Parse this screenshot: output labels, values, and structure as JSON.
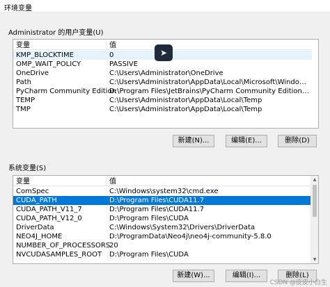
{
  "window": {
    "title": "环境变量"
  },
  "user_vars": {
    "group_label": "Administrator 的用户变量(U)",
    "columns": [
      "变量",
      "值"
    ],
    "rows": [
      {
        "name": "KMP_BLOCKTIME",
        "value": "0"
      },
      {
        "name": "OMP_WAIT_POLICY",
        "value": "PASSIVE"
      },
      {
        "name": "OneDrive",
        "value": "C:\\Users\\Administrator\\OneDrive"
      },
      {
        "name": "Path",
        "value": "C:\\Users\\Administrator\\AppData\\Local\\Microsoft\\WindowsApps;D..."
      },
      {
        "name": "PyCharm Community Edition",
        "value": "D:\\Program Files\\JetBrains\\PyCharm Community Edition 2022.3.2\\..."
      },
      {
        "name": "TEMP",
        "value": "C:\\Users\\Administrator\\AppData\\Local\\Temp"
      },
      {
        "name": "TMP",
        "value": "C:\\Users\\Administrator\\AppData\\Local\\Temp"
      }
    ],
    "buttons": {
      "new": "新建(N)...",
      "edit": "编辑(E)...",
      "delete": "删除(D)"
    }
  },
  "system_vars": {
    "group_label": "系统变量(S)",
    "columns": [
      "变量",
      "值"
    ],
    "rows": [
      {
        "name": "ComSpec",
        "value": "C:\\Windows\\system32\\cmd.exe"
      },
      {
        "name": "CUDA_PATH",
        "value": "D:\\Program Files\\CUDA11.7"
      },
      {
        "name": "CUDA_PATH_V11_7",
        "value": "D:\\Program Files\\CUDA11.7"
      },
      {
        "name": "CUDA_PATH_V12_0",
        "value": "D:\\Program Files\\CUDA"
      },
      {
        "name": "DriverData",
        "value": "C:\\Windows\\System32\\Drivers\\DriverData"
      },
      {
        "name": "NEO4J_HOME",
        "value": "D:\\ProgramData\\Neo4j\\neo4j-community-5.8.0"
      },
      {
        "name": "NUMBER_OF_PROCESSORS",
        "value": "20"
      },
      {
        "name": "NVCUDASAMPLES_ROOT",
        "value": "D:\\Program Files\\CUDA"
      }
    ],
    "selected_index": 1,
    "buttons": {
      "new": "新建(W)...",
      "edit": "编辑(I)...",
      "delete": "删除(L)"
    }
  },
  "watermark": "CSDN @皮皮小白生",
  "floating_icon": "assistant-app-icon"
}
